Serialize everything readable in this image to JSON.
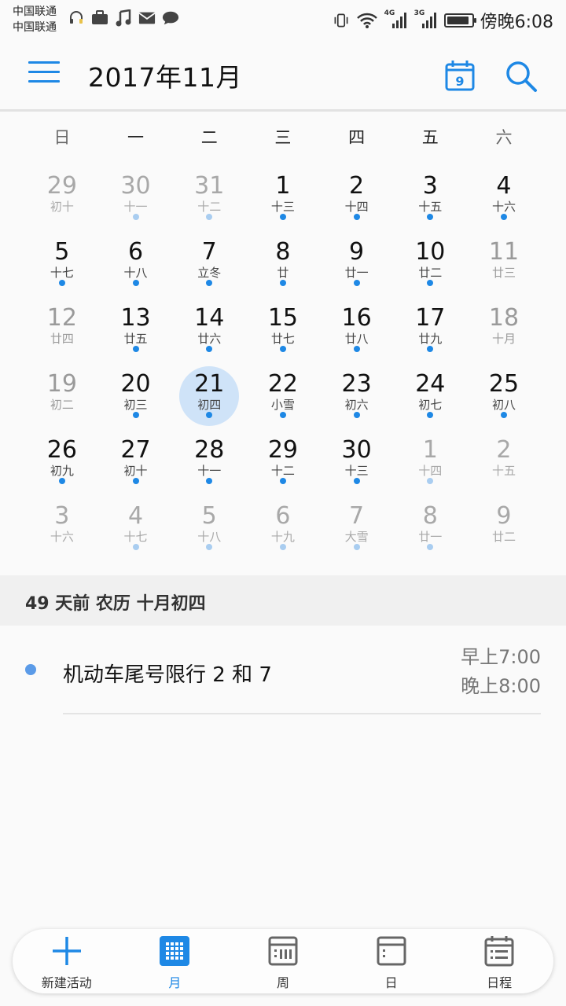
{
  "status_bar": {
    "carrier_1": "中国联通",
    "carrier_2": "中国联通",
    "network_4g": "4G",
    "network_3g": "3G",
    "time": "傍晚6:08",
    "battery_level": 0.9
  },
  "app_bar": {
    "title": "2017年11月",
    "today_day": "9",
    "accent_color": "#1e88e5"
  },
  "weekdays": [
    "日",
    "一",
    "二",
    "三",
    "四",
    "五",
    "六"
  ],
  "weeks": [
    [
      {
        "day": "29",
        "lunar": "初十",
        "muted": true,
        "dot": false
      },
      {
        "day": "30",
        "lunar": "十一",
        "muted": true,
        "dot": true
      },
      {
        "day": "31",
        "lunar": "十二",
        "muted": true,
        "dot": true
      },
      {
        "day": "1",
        "lunar": "十三",
        "muted": false,
        "dot": true
      },
      {
        "day": "2",
        "lunar": "十四",
        "muted": false,
        "dot": true
      },
      {
        "day": "3",
        "lunar": "十五",
        "muted": false,
        "dot": true
      },
      {
        "day": "4",
        "lunar": "十六",
        "muted": false,
        "dot": true
      }
    ],
    [
      {
        "day": "5",
        "lunar": "十七",
        "muted": false,
        "dot": true
      },
      {
        "day": "6",
        "lunar": "十八",
        "muted": false,
        "dot": true
      },
      {
        "day": "7",
        "lunar": "立冬",
        "muted": false,
        "dot": true
      },
      {
        "day": "8",
        "lunar": "廿",
        "muted": false,
        "dot": true
      },
      {
        "day": "9",
        "lunar": "廿一",
        "muted": false,
        "dot": true
      },
      {
        "day": "10",
        "lunar": "廿二",
        "muted": false,
        "dot": true
      },
      {
        "day": "11",
        "lunar": "廿三",
        "muted": false,
        "dot": false
      }
    ],
    [
      {
        "day": "12",
        "lunar": "廿四",
        "muted": false,
        "dot": false
      },
      {
        "day": "13",
        "lunar": "廿五",
        "muted": false,
        "dot": true
      },
      {
        "day": "14",
        "lunar": "廿六",
        "muted": false,
        "dot": true
      },
      {
        "day": "15",
        "lunar": "廿七",
        "muted": false,
        "dot": true
      },
      {
        "day": "16",
        "lunar": "廿八",
        "muted": false,
        "dot": true
      },
      {
        "day": "17",
        "lunar": "廿九",
        "muted": false,
        "dot": true
      },
      {
        "day": "18",
        "lunar": "十月",
        "muted": false,
        "dot": false
      }
    ],
    [
      {
        "day": "19",
        "lunar": "初二",
        "muted": false,
        "dot": false
      },
      {
        "day": "20",
        "lunar": "初三",
        "muted": false,
        "dot": true
      },
      {
        "day": "21",
        "lunar": "初四",
        "muted": false,
        "dot": true,
        "selected": true
      },
      {
        "day": "22",
        "lunar": "小雪",
        "muted": false,
        "dot": true
      },
      {
        "day": "23",
        "lunar": "初六",
        "muted": false,
        "dot": true
      },
      {
        "day": "24",
        "lunar": "初七",
        "muted": false,
        "dot": true
      },
      {
        "day": "25",
        "lunar": "初八",
        "muted": false,
        "dot": true
      }
    ],
    [
      {
        "day": "26",
        "lunar": "初九",
        "muted": false,
        "dot": true
      },
      {
        "day": "27",
        "lunar": "初十",
        "muted": false,
        "dot": true
      },
      {
        "day": "28",
        "lunar": "十一",
        "muted": false,
        "dot": true
      },
      {
        "day": "29",
        "lunar": "十二",
        "muted": false,
        "dot": true
      },
      {
        "day": "30",
        "lunar": "十三",
        "muted": false,
        "dot": true
      },
      {
        "day": "1",
        "lunar": "十四",
        "muted": true,
        "dot": true
      },
      {
        "day": "2",
        "lunar": "十五",
        "muted": true,
        "dot": false
      }
    ],
    [
      {
        "day": "3",
        "lunar": "十六",
        "muted": true,
        "dot": false
      },
      {
        "day": "4",
        "lunar": "十七",
        "muted": true,
        "dot": true
      },
      {
        "day": "5",
        "lunar": "十八",
        "muted": true,
        "dot": true
      },
      {
        "day": "6",
        "lunar": "十九",
        "muted": true,
        "dot": true
      },
      {
        "day": "7",
        "lunar": "大雪",
        "muted": true,
        "dot": true
      },
      {
        "day": "8",
        "lunar": "廿一",
        "muted": true,
        "dot": true
      },
      {
        "day": "9",
        "lunar": "廿二",
        "muted": true,
        "dot": false
      }
    ]
  ],
  "info_band": {
    "text": "49 天前  农历 十月初四"
  },
  "events": [
    {
      "title": "机动车尾号限行 2 和 7",
      "start": "早上7:00",
      "end": "晚上8:00",
      "color": "#5b9be8"
    }
  ],
  "bottom_nav": [
    {
      "id": "new",
      "label": "新建活动",
      "icon": "plus-icon",
      "active": false
    },
    {
      "id": "month",
      "label": "月",
      "icon": "month-grid-icon",
      "active": true
    },
    {
      "id": "week",
      "label": "周",
      "icon": "week-view-icon",
      "active": false
    },
    {
      "id": "day",
      "label": "日",
      "icon": "day-view-icon",
      "active": false
    },
    {
      "id": "agenda",
      "label": "日程",
      "icon": "agenda-list-icon",
      "active": false
    }
  ]
}
